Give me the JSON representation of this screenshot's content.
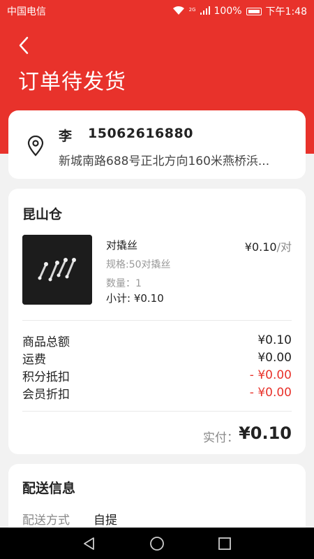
{
  "status_bar": {
    "carrier": "中国电信",
    "network": "2G",
    "battery": "100%",
    "time": "下午1:48"
  },
  "header": {
    "title": "订单待发货"
  },
  "address": {
    "name": "李",
    "phone": "15062616880",
    "detail": "新城南路688号正北方向160米燕桥浜..."
  },
  "order": {
    "warehouse": "昆山仓",
    "product": {
      "name": "对撬丝",
      "price": "¥0.10",
      "price_unit": "/对",
      "spec": "规格:50对撬丝",
      "quantity": "数量：1",
      "subtotal": "小计: ¥0.10"
    },
    "summary": [
      {
        "label": "商品总额",
        "value": "¥0.10"
      },
      {
        "label": "运费",
        "value": "¥0.00"
      },
      {
        "label": "积分抵扣",
        "value": "- ¥0.00"
      },
      {
        "label": "会员折扣",
        "value": "- ¥0.00"
      }
    ],
    "paid_label": "实付：",
    "paid_value": "¥0.10"
  },
  "shipping": {
    "title": "配送信息",
    "method_label": "配送方式",
    "method_value": "自提"
  },
  "colors": {
    "accent": "#e8322b"
  }
}
